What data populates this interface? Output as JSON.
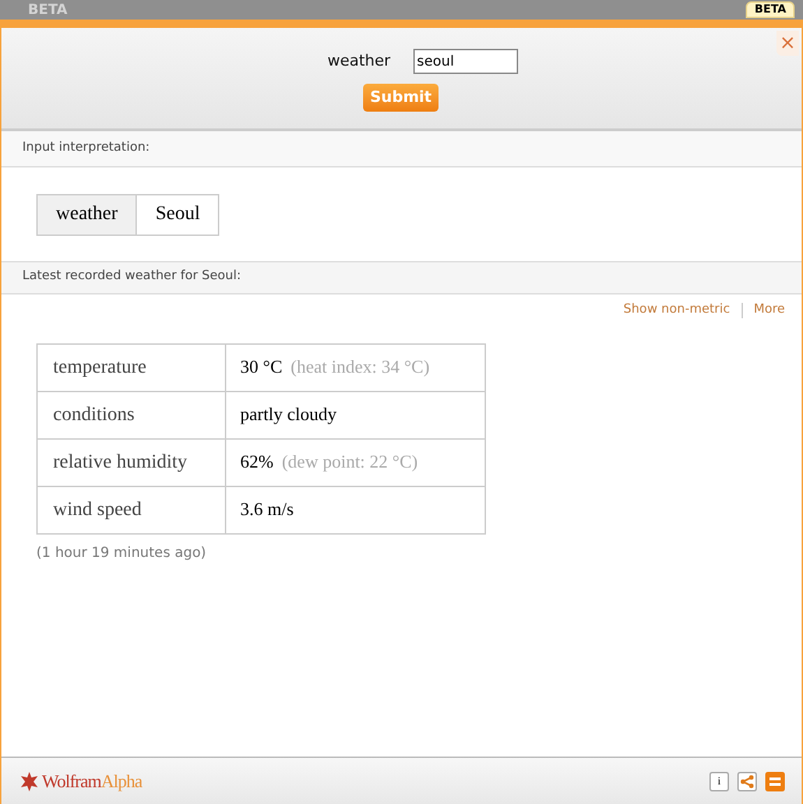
{
  "background_label": "BETA",
  "beta_tab": "BETA",
  "close": "×",
  "query": {
    "label": "weather",
    "value": "seoul",
    "submit": "Submit"
  },
  "interpretation": {
    "title": "Input interpretation:",
    "parts": [
      "weather",
      "Seoul"
    ]
  },
  "result": {
    "title": "Latest recorded weather for Seoul:",
    "links": [
      "Show non-metric",
      "More"
    ],
    "rows": [
      {
        "label": "temperature",
        "value": "30 °C",
        "note": "(heat index: 34 °C)"
      },
      {
        "label": "conditions",
        "value": "partly cloudy"
      },
      {
        "label": "relative humidity",
        "value": "62%",
        "note": "(dew point: 22 °C)"
      },
      {
        "label": "wind speed",
        "value": "3.6 m/s"
      }
    ],
    "age": "(1 hour 19 minutes ago)"
  },
  "footer": {
    "brand": [
      "Wolfram",
      "Alpha"
    ],
    "info": "i"
  }
}
